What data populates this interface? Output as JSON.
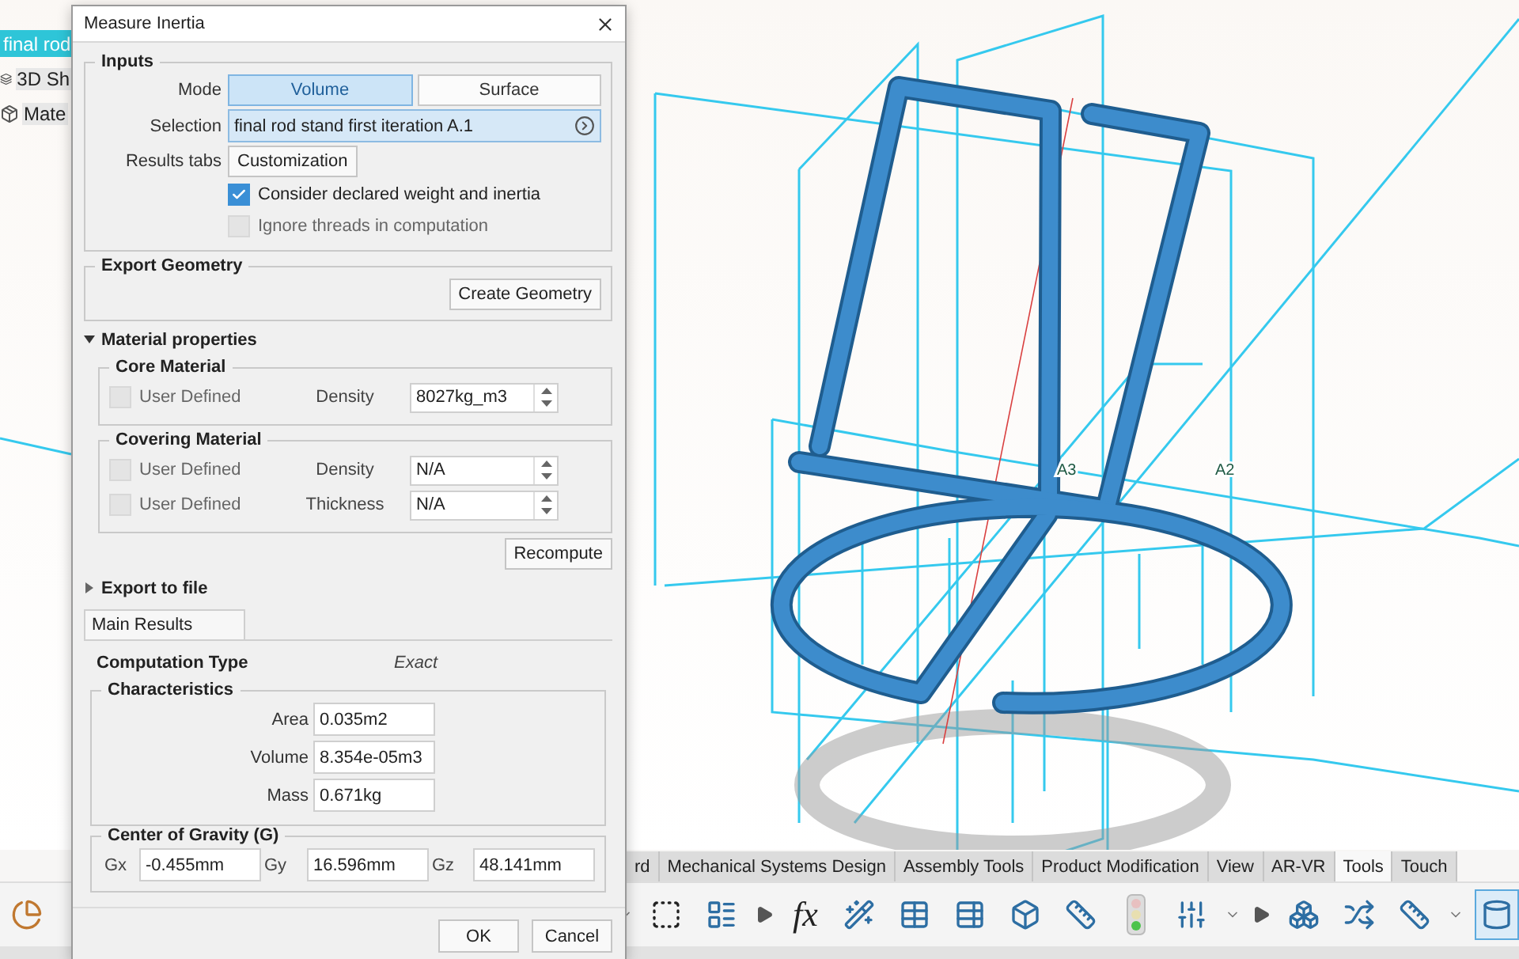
{
  "tree": {
    "items": [
      {
        "label": "final rod",
        "selected": true,
        "kind": "part"
      },
      {
        "label": "3D Sh",
        "selected": false,
        "kind": "shape"
      },
      {
        "label": "Mate",
        "selected": false,
        "kind": "material"
      }
    ]
  },
  "viewport": {
    "axis_labels": [
      "A3",
      "A2"
    ]
  },
  "dialog": {
    "title": "Measure Inertia",
    "inputs": {
      "title": "Inputs",
      "mode_label": "Mode",
      "modes": [
        {
          "label": "Volume",
          "selected": true
        },
        {
          "label": "Surface",
          "selected": false
        }
      ],
      "selection_label": "Selection",
      "selection_value": "final rod stand first iteration A.1",
      "results_tabs_label": "Results tabs",
      "customization_button": "Customization",
      "options": [
        {
          "label": "Consider declared weight and inertia",
          "checked": true,
          "disabled": false
        },
        {
          "label": "Ignore threads in computation",
          "checked": false,
          "disabled": true
        }
      ]
    },
    "export_geometry": {
      "title": "Export Geometry",
      "button": "Create Geometry"
    },
    "material_properties": {
      "title": "Material properties",
      "expanded": true,
      "groups": [
        {
          "title": "Core Material",
          "rows": [
            {
              "checkbox_label": "User Defined",
              "checked": false,
              "disabled": true,
              "label": "Density",
              "value": "8027kg_m3"
            }
          ]
        },
        {
          "title": "Covering Material",
          "rows": [
            {
              "checkbox_label": "User Defined",
              "checked": false,
              "disabled": true,
              "label": "Density",
              "value": "N/A"
            },
            {
              "checkbox_label": "User Defined",
              "checked": false,
              "disabled": true,
              "label": "Thickness",
              "value": "N/A"
            }
          ]
        }
      ],
      "recompute_button": "Recompute"
    },
    "export_to_file": {
      "title": "Export to file",
      "expanded": false
    },
    "results_tabs": [
      {
        "label": "Main Results",
        "selected": true
      }
    ],
    "computation_type": {
      "label": "Computation Type",
      "value": "Exact"
    },
    "characteristics": {
      "title": "Characteristics",
      "fields": [
        {
          "label": "Area",
          "value": "0.035m2"
        },
        {
          "label": "Volume",
          "value": "8.354e-05m3"
        },
        {
          "label": "Mass",
          "value": "0.671kg"
        }
      ]
    },
    "center_of_gravity": {
      "title": "Center of Gravity (G)",
      "fields": [
        {
          "label": "Gx",
          "value": "-0.455mm"
        },
        {
          "label": "Gy",
          "value": "16.596mm"
        },
        {
          "label": "Gz",
          "value": "48.141mm"
        }
      ]
    },
    "buttons": [
      "OK",
      "Cancel"
    ]
  },
  "ribbon": {
    "tabs": [
      {
        "label": "rd",
        "selected": false
      },
      {
        "label": "Mechanical Systems Design",
        "selected": false
      },
      {
        "label": "Assembly Tools",
        "selected": false
      },
      {
        "label": "Product Modification",
        "selected": false
      },
      {
        "label": "View",
        "selected": false
      },
      {
        "label": "AR-VR",
        "selected": false
      },
      {
        "label": "Tools",
        "selected": true
      },
      {
        "label": "Touch",
        "selected": false
      }
    ],
    "formula_label": "fx"
  }
}
